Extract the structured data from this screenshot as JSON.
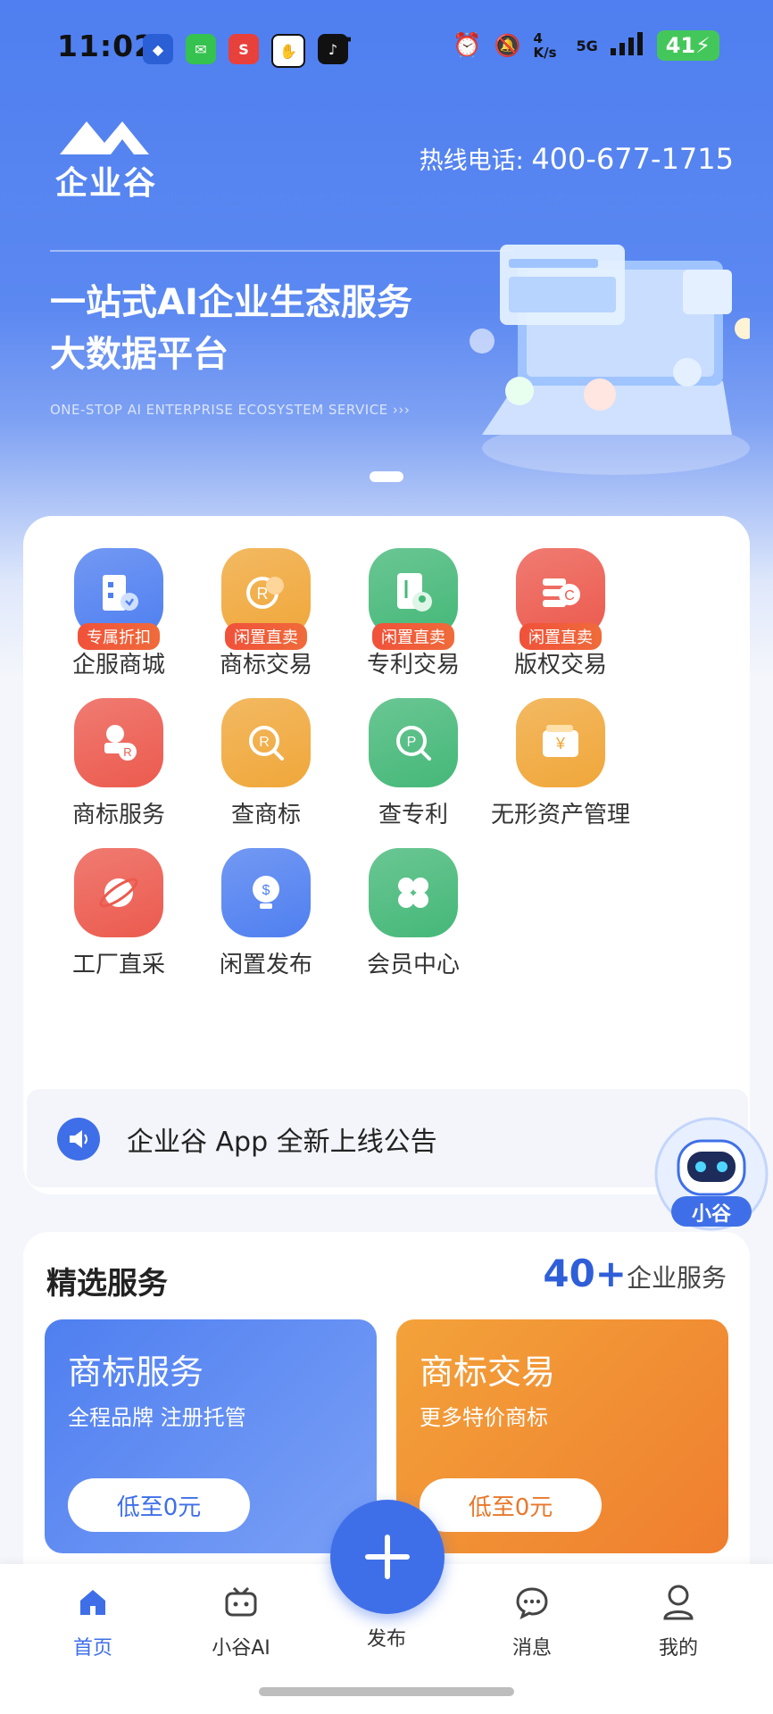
{
  "status_bar": {
    "time": "11:02",
    "network_speed": "4 K/s",
    "signal": "5G",
    "battery": "41"
  },
  "header": {
    "logo_text": "企业谷",
    "hotline_label": "热线电话:",
    "hotline_number": "400-677-1715"
  },
  "banner": {
    "title_line1": "一站式AI企业生态服务",
    "title_line2": "大数据平台",
    "subtitle": "ONE-STOP AI ENTERPRISE ECOSYSTEM SERVICE  ›››"
  },
  "grid": [
    {
      "label": "企服商城",
      "badge": "专属折扣",
      "color": "#4f7ff0",
      "icon": "building-icon"
    },
    {
      "label": "商标交易",
      "badge": "闲置直卖",
      "color": "#f0a73a",
      "icon": "trademark-icon"
    },
    {
      "label": "专利交易",
      "badge": "闲置直卖",
      "color": "#45b878",
      "icon": "patent-doc-icon"
    },
    {
      "label": "版权交易",
      "badge": "闲置直卖",
      "color": "#ec5a4e",
      "icon": "copyright-icon"
    },
    {
      "label": "商标服务",
      "color": "#ec5a4e",
      "icon": "stamp-icon"
    },
    {
      "label": "查商标",
      "color": "#f0a73a",
      "icon": "search-trademark-icon"
    },
    {
      "label": "查专利",
      "color": "#45b878",
      "icon": "search-patent-icon"
    },
    {
      "label": "无形资产管理",
      "color": "#f0a73a",
      "icon": "wallet-icon"
    },
    {
      "label": "工厂直采",
      "color": "#ec5a4e",
      "icon": "planet-icon"
    },
    {
      "label": "闲置发布",
      "color": "#4f7ff0",
      "icon": "lightbulb-icon"
    },
    {
      "label": "会员中心",
      "color": "#45b878",
      "icon": "clover-icon"
    }
  ],
  "notice": {
    "text": "企业谷 App 全新上线公告"
  },
  "assistant": {
    "label": "小谷"
  },
  "featured": {
    "title": "精选服务",
    "count": "40+",
    "count_label": "企业服务",
    "tiles": [
      {
        "title": "商标服务",
        "subtitle": "全程品牌 注册托管",
        "button": "低至0元",
        "button_color": "#3f6fe8"
      },
      {
        "title": "商标交易",
        "subtitle": "更多特价商标",
        "button": "低至0元",
        "button_color": "#e8782c"
      }
    ]
  },
  "tabbar": [
    {
      "label": "首页",
      "active": true
    },
    {
      "label": "小谷AI"
    },
    {
      "label": "发布"
    },
    {
      "label": "消息"
    },
    {
      "label": "我的"
    }
  ],
  "colors": {
    "primary": "#3f6fe8",
    "badge": "#f0513a"
  }
}
